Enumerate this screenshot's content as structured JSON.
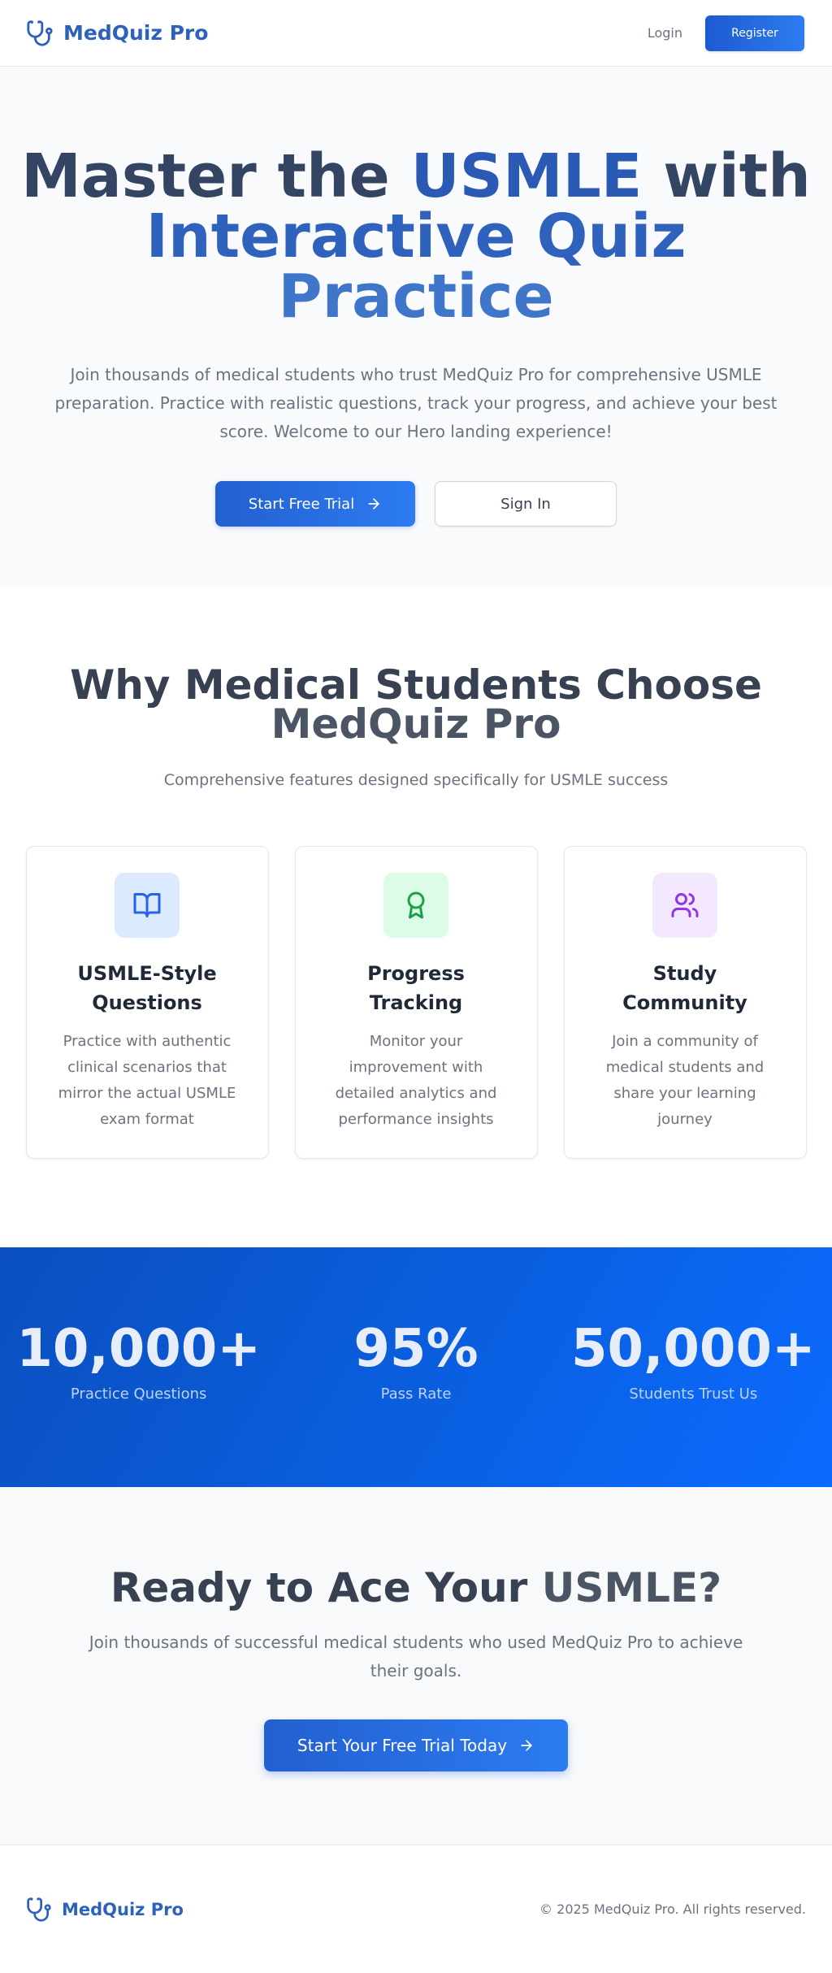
{
  "nav": {
    "brand": "MedQuiz Pro",
    "brand_icon": "stethoscope-icon",
    "login_label": "Login",
    "register_label": "Register"
  },
  "hero": {
    "title_part1": "Master the",
    "title_highlight1": "USMLE",
    "title_part2": "with",
    "title_highlight2": "Interactive Quiz",
    "title_highlight3": "Practice",
    "subtitle": "Join thousands of medical students who trust MedQuiz Pro for comprehensive USMLE preparation. Practice with realistic questions, track your progress, and achieve your best score. Welcome to our Hero landing experience!",
    "primary_button": "Start Free Trial",
    "secondary_button": "Sign In"
  },
  "features": {
    "title_line1": "Why Medical Students Choose",
    "title_line2": "MedQuiz Pro",
    "subtitle": "Comprehensive features designed specifically for USMLE success",
    "cards": [
      {
        "icon": "book-open-icon",
        "title": "USMLE-Style Questions",
        "description": "Practice with authentic clinical scenarios that mirror the actual USMLE exam format",
        "color": "#2563eb"
      },
      {
        "icon": "award-icon",
        "title": "Progress Tracking",
        "description": "Monitor your improvement with detailed analytics and performance insights",
        "color": "#16a34a"
      },
      {
        "icon": "users-icon",
        "title": "Study Community",
        "description": "Join a community of medical students and share your learning journey",
        "color": "#9333ea"
      }
    ]
  },
  "stats": [
    {
      "value": "10,000+",
      "label": "Practice Questions"
    },
    {
      "value": "95%",
      "label": "Pass Rate"
    },
    {
      "value": "50,000+",
      "label": "Students Trust Us"
    }
  ],
  "cta": {
    "title_part1": "Ready to Ace Your",
    "title_part2": "USMLE?",
    "subtitle": "Join thousands of successful medical students who used MedQuiz Pro to achieve their goals.",
    "button": "Start Your Free Trial Today"
  },
  "footer": {
    "brand": "MedQuiz Pro",
    "copyright": "© 2025 MedQuiz Pro. All rights reserved."
  },
  "colors": {
    "brand_blue": "#2d62bc",
    "primary": "#2563eb",
    "stats_bg": "#0a5fe0"
  }
}
